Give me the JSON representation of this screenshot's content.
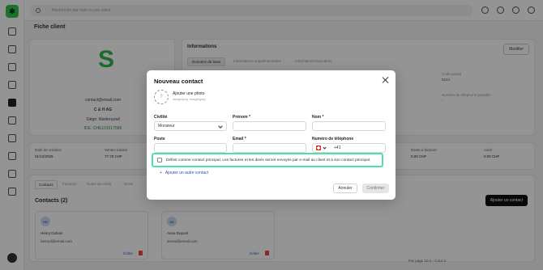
{
  "topbar": {
    "search_placeholder": "Recherche par nom ou par client"
  },
  "page": {
    "title": "Fiche client"
  },
  "client": {
    "email": "contact@email.com",
    "name": "C & H AG",
    "siege": "Siège: Niederuzwil",
    "ide": "IDE: CHE101617586"
  },
  "info": {
    "title": "Informations",
    "edit_label": "Modifier",
    "tabs": [
      "Données de base",
      "Informations supplémentaires",
      "Informations bancaires"
    ],
    "fields": [
      {
        "label": "Code postal",
        "value": "9244"
      },
      {
        "label": "Numéro de téléphone portable",
        "value": "-"
      }
    ]
  },
  "stats": [
    {
      "label": "Date de création",
      "value": "01/12/2025"
    },
    {
      "label": "Ventes totales",
      "value": "77.78 CHF"
    },
    {
      "label": "Reste à facturer",
      "value": "0.00 CHF"
    },
    {
      "label": "Avoir",
      "value": "0.00 CHF"
    }
  ],
  "contacts": {
    "tabs": [
      "Contacts",
      "Factures",
      "Notes de crédit",
      "Devis"
    ],
    "title": "Contacts (2)",
    "add_label": "Ajouter un contact",
    "items": [
      {
        "initials": "HD",
        "name": "Henry Dubois",
        "email": "henryd@email.com",
        "edit": "Éditer"
      },
      {
        "initials": "AD",
        "name": "Anne Dupont",
        "email": "anned@email.com",
        "edit": "Éditer"
      }
    ],
    "pager": "Par page 10  1 - 2 sur 2"
  },
  "modal": {
    "title": "Nouveau contact",
    "photo_label": "Ajouter une photo",
    "photo_hint": "image/png, image/jpeg",
    "civilite_label": "Civilité",
    "civilite_value": "Monsieur",
    "prenom_label": "Prénom *",
    "nom_label": "Nom *",
    "poste_label": "Poste",
    "email_label": "Email *",
    "phone_label": "Numéro de téléphone",
    "phone_prefix": "+41",
    "principal_text": "Définit comme contact principal. Les factures et les devis seront envoyés par e-mail au client et à son contact principal.",
    "add_other": "Ajouter un autre contact",
    "cancel_label": "Annuler",
    "confirm_label": "Confirmer"
  },
  "colors": {
    "highlight": "#4fe0a8",
    "brand_green": "#33c24f",
    "link_blue": "#2a4fb0"
  }
}
